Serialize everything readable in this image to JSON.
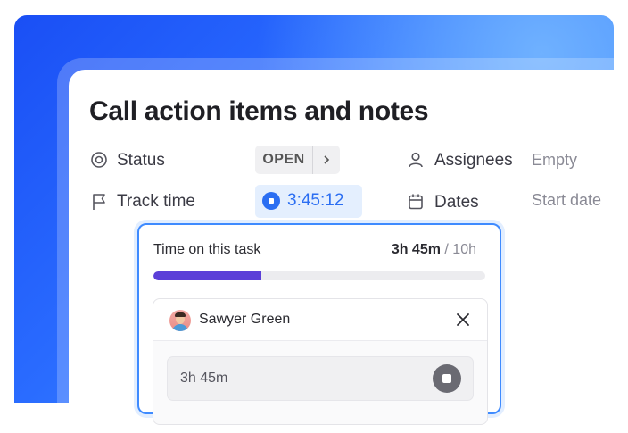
{
  "task": {
    "title": "Call action items and notes"
  },
  "fields": {
    "status": {
      "label": "Status",
      "value": "OPEN"
    },
    "track_time": {
      "label": "Track time",
      "value": "3:45:12"
    },
    "assignees": {
      "label": "Assignees",
      "value": "Empty"
    },
    "dates": {
      "label": "Dates",
      "value": "Start date"
    }
  },
  "time_popover": {
    "title": "Time on this task",
    "tracked": "3h 45m",
    "limit": "/ 10h",
    "progress_fraction": 0.325,
    "progress_color": "#5b3fd8",
    "entry": {
      "user_name": "Sawyer Green",
      "duration": "3h 45m"
    }
  },
  "colors": {
    "accent": "#2b6ef2",
    "timer_bg": "#e4effe"
  },
  "icons": [
    "status-icon",
    "flag-icon",
    "person-icon",
    "calendar-icon",
    "chevron-right-icon",
    "stop-icon",
    "close-icon"
  ]
}
